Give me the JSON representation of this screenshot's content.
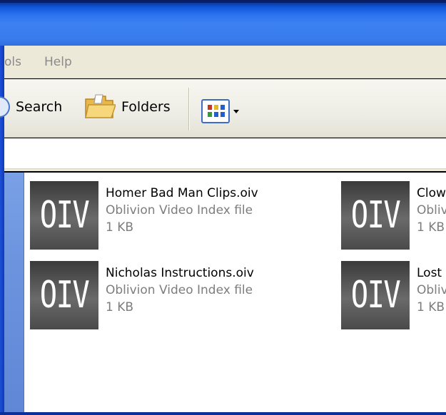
{
  "menu": {
    "tools_partial": "ols",
    "help": "Help"
  },
  "toolbar": {
    "search_label": "Search",
    "folders_label": "Folders"
  },
  "icons": {
    "file_icon_text": "OIV"
  },
  "files": [
    {
      "name": "Homer Bad Man Clips.oiv",
      "type": "Oblivion Video Index file",
      "size": "1 KB"
    },
    {
      "name": "Clow",
      "type": "Obliv",
      "size": "1 KB"
    },
    {
      "name": "Nicholas Instructions.oiv",
      "type": "Oblivion Video Index file",
      "size": "1 KB"
    },
    {
      "name": "Lost",
      "type": "Obliv",
      "size": "1 KB"
    }
  ],
  "colors": {
    "titlebar_blue": "#2f6fe0",
    "menubar_bg": "#ece9d8",
    "taskpane_blue": "#6b93de",
    "secondary_text": "#7d7d7d"
  }
}
